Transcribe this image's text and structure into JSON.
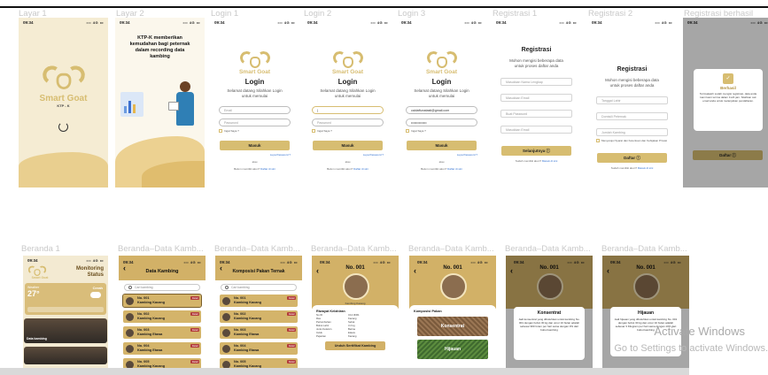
{
  "labels": {
    "layar1": "Layar 1",
    "layar2": "Layar 2",
    "login1": "Login 1",
    "login2": "Login 2",
    "login3": "Login 3",
    "reg1": "Registrasi 1",
    "reg2": "Registrasi 2",
    "reg3": "Registrasi berhasil",
    "b1": "Beranda 1",
    "b2": "Beranda–Data Kamb...",
    "b3": "Beranda–Data Kamb...",
    "b4": "Beranda–Data Kamb...",
    "b5": "Beranda–Data Kamb...",
    "b6": "Beranda–Data Kamb...",
    "b7": "Beranda–Data Kamb..."
  },
  "status": {
    "time": "09:34",
    "icons": "••• 4G ▭"
  },
  "splash": {
    "brand": "Smart Goat",
    "tag": "KTP - K"
  },
  "intro": {
    "text": "KTP-K memberikan kemudahan bagi peternak dalam recording data kambing"
  },
  "login": {
    "brand": "Smart Goat",
    "title": "Login",
    "subtitle": "Selamat datang Silahkan Login untuk memulai",
    "email_ph": "Email",
    "pass_ph": "Password",
    "remember": "Ingat Saya ?",
    "forgot": "Lupa Password ?",
    "button": "Masuk",
    "or": "atau",
    "no_account": "Belum memiliki akun?",
    "register": "Daftar di sini",
    "email_filled": "caldaftunatasti@gmail.com",
    "pass_filled": "••••••••••••••"
  },
  "reg1": {
    "title": "Registrasi",
    "subtitle": "Mohon mengisi beberapa data untuk proses daftar anda",
    "f1": "Masukkan Nama Lengkap",
    "f2": "Masukkan Email",
    "f3": "Buat Password",
    "f4": "Masukkan Email",
    "button": "Selanjutnya ⓘ",
    "have": "Sudah memiliki akun?",
    "masuk": "Masuk di sini"
  },
  "reg2": {
    "title": "Registrasi",
    "subtitle": "Mohon mengisi beberapa data untuk proses daftar anda",
    "f1": "Tanggal Lahir",
    "f2": "Domisili Peternak",
    "f3": "Jumlah Kambing",
    "terms": "Menyetujui Syarat dan Ketentuan dan Kebijakan Privasi",
    "button": "Daftar ⓘ",
    "have": "Sudah memiliki akun?",
    "masuk": "Masuk di sini"
  },
  "reg3": {
    "result": "Berhasil",
    "desc": "Terimakasih sudah mengisi registrasi, data anda kami kami terima dalam 1x24 jam. Silahkan cek email anda untuk melanjutkan pendaftaran."
  },
  "dash": {
    "brand": "Smart Goat",
    "title": "Monitoring Status",
    "weather_label": "Weather",
    "temp": "27°",
    "weather_text": "Cerah",
    "photo_label": "Data kambing"
  },
  "datakambing": {
    "title": "Data Kambing",
    "search_ph": "Cari kambing",
    "items": [
      {
        "no": "No. 001",
        "name": "Kambing Kacang"
      },
      {
        "no": "No. 002",
        "name": "Kambing Kacang"
      },
      {
        "no": "No. 003",
        "name": "Kambing Etawa"
      },
      {
        "no": "No. 004",
        "name": "Kambing Etawa"
      },
      {
        "no": "No. 005",
        "name": "Kambing Kacang"
      }
    ],
    "tag": "Detail"
  },
  "pakan": {
    "title": "Komposisi Pakan Ternak",
    "search_ph": "Cari kambing",
    "items": [
      {
        "no": "No. 001",
        "name": "Kambing Kacang"
      },
      {
        "no": "No. 002",
        "name": "Kambing Kacang"
      },
      {
        "no": "No. 003",
        "name": "Kambing Etawa"
      },
      {
        "no": "No. 004",
        "name": "Kambing Etawa"
      },
      {
        "no": "No. 005",
        "name": "Kambing Kacang"
      }
    ]
  },
  "detail": {
    "no": "No. 001",
    "goat_name": "Kambing Kacang",
    "section": "Riwayat Kelahiran",
    "rows": [
      {
        "k": "No ID",
        "v": "C12 3D61"
      },
      {
        "k": "Ras",
        "v": "Kacang"
      },
      {
        "k": "Pertumbuhan",
        "v": "Sehat"
      },
      {
        "k": "Bobot Lahir",
        "v": "3.2 kg"
      },
      {
        "k": "Jenis Kelamin",
        "v": "Betina"
      },
      {
        "k": "Induk",
        "v": "Etawa"
      },
      {
        "k": "Pejantan",
        "v": "Kacang"
      }
    ],
    "button": "Unduh Sertifikat Kambing"
  },
  "komposisi": {
    "no": "No. 001",
    "section": "Komposisi Pakan",
    "konsentrat": "Konsentrat",
    "hijauan": "Hijauan"
  },
  "konsentrat_popup": {
    "title": "Konsentrat",
    "text": "Jadi konsentrat yang dibutuhkan untuk kambing No. 001 dengan bobot 30 kg dan umur 10 bulan adalah sebesar 900 Gram per hari sama dengan 3% dari bobot kambing"
  },
  "hijauan_popup": {
    "title": "Hijauan",
    "text": "Jadi hijauan yang dibutuhkan untuk kambing No. 001 dengan bobot 30 kg dan umur 10 bulan adalah sebesar 3 Kilogram per hari sama dengan 10% dari bobot kambing"
  },
  "windows": {
    "line1": "Activate Windows",
    "line2": "Go to Settings to activate Windows."
  }
}
